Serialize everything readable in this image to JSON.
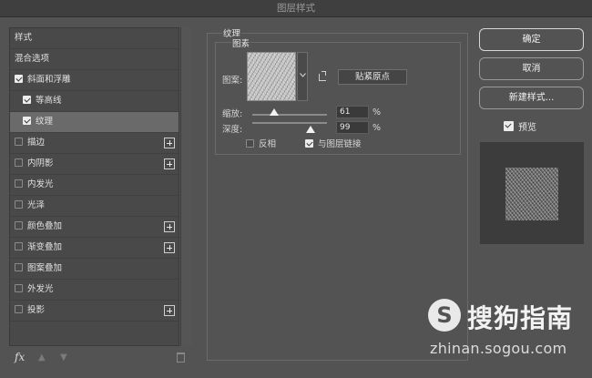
{
  "window": {
    "title": "图层样式"
  },
  "sidebar": {
    "header": "样式",
    "items": [
      {
        "label": "混合选项",
        "checkbox": false,
        "has_checkbox": false,
        "plus": false
      },
      {
        "label": "斜面和浮雕",
        "checkbox": true,
        "has_checkbox": true,
        "plus": false
      },
      {
        "label": "等高线",
        "checkbox": true,
        "has_checkbox": true,
        "plus": false,
        "indent": true
      },
      {
        "label": "纹理",
        "checkbox": true,
        "has_checkbox": true,
        "plus": false,
        "indent": true,
        "selected": true
      },
      {
        "label": "描边",
        "checkbox": false,
        "has_checkbox": true,
        "plus": true
      },
      {
        "label": "内阴影",
        "checkbox": false,
        "has_checkbox": true,
        "plus": true
      },
      {
        "label": "内发光",
        "checkbox": false,
        "has_checkbox": true,
        "plus": false
      },
      {
        "label": "光泽",
        "checkbox": false,
        "has_checkbox": true,
        "plus": false
      },
      {
        "label": "颜色叠加",
        "checkbox": false,
        "has_checkbox": true,
        "plus": true
      },
      {
        "label": "渐变叠加",
        "checkbox": false,
        "has_checkbox": true,
        "plus": true
      },
      {
        "label": "图案叠加",
        "checkbox": false,
        "has_checkbox": true,
        "plus": false
      },
      {
        "label": "外发光",
        "checkbox": false,
        "has_checkbox": true,
        "plus": false
      },
      {
        "label": "投影",
        "checkbox": false,
        "has_checkbox": true,
        "plus": true
      }
    ],
    "fx_label": "fx"
  },
  "texture": {
    "group_title": "纹理",
    "sub_title": "图素",
    "pattern_label": "图案:",
    "snap_button": "贴紧原点",
    "scale_label": "缩放:",
    "scale_value": "61",
    "scale_unit": "%",
    "depth_label": "深度:",
    "depth_value": "99",
    "depth_unit": "%",
    "invert_label": "反相",
    "invert_checked": false,
    "link_label": "与图层链接",
    "link_checked": true
  },
  "actions": {
    "ok": "确定",
    "cancel": "取消",
    "new_style": "新建样式...",
    "preview_label": "预览",
    "preview_checked": true
  },
  "watermark": {
    "logo_letter": "S",
    "title": "搜狗指南",
    "url": "zhinan.sogou.com"
  }
}
